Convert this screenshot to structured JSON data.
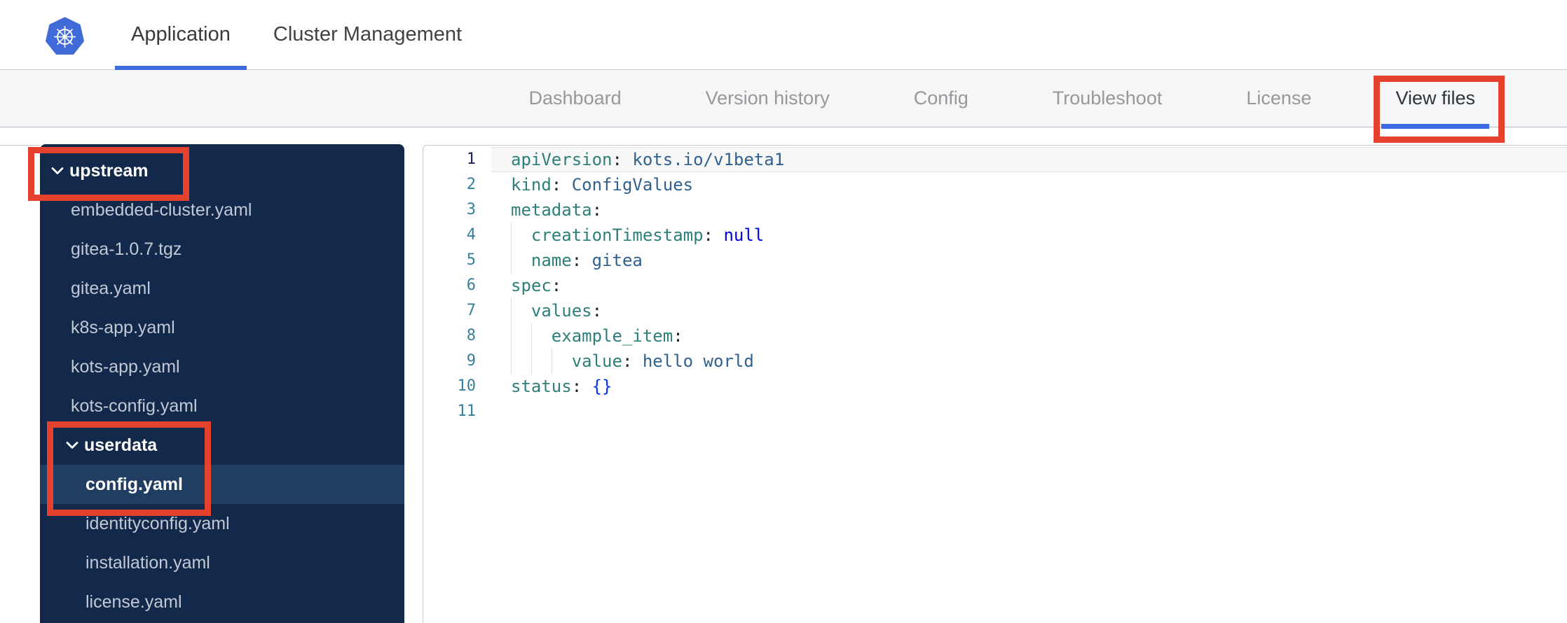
{
  "colors": {
    "header_accent_blue": "#3e6be0",
    "tab_accent_blue": "#3b6ce4",
    "annotation_red": "#e5412d",
    "kubernetes_logo_blue": "#3f6ad8",
    "sidebar_bg": "#13294b",
    "sidebar_selected_bg": "#1f3e61",
    "code_key_teal": "#2e7f79",
    "code_value_blue": "#31618f",
    "code_keyword_blue": "#0000ee",
    "code_bracket_blue": "#0431fa",
    "line_number": "#37809c",
    "line_number_active": "#1b2450"
  },
  "header": {
    "tabs": [
      {
        "label": "Application",
        "active": true
      },
      {
        "label": "Cluster Management",
        "active": false
      }
    ]
  },
  "subnav": {
    "tabs": [
      {
        "label": "Dashboard",
        "active": false
      },
      {
        "label": "Version history",
        "active": false
      },
      {
        "label": "Config",
        "active": false
      },
      {
        "label": "Troubleshoot",
        "active": false
      },
      {
        "label": "License",
        "active": false
      },
      {
        "label": "View files",
        "active": true,
        "annotated": true
      }
    ]
  },
  "file_tree": {
    "items": [
      {
        "type": "folder",
        "label": "upstream",
        "level": 0,
        "expanded": true,
        "annotated": "upstream"
      },
      {
        "type": "file",
        "label": "embedded-cluster.yaml",
        "level": 1
      },
      {
        "type": "file",
        "label": "gitea-1.0.7.tgz",
        "level": 1
      },
      {
        "type": "file",
        "label": "gitea.yaml",
        "level": 1
      },
      {
        "type": "file",
        "label": "k8s-app.yaml",
        "level": 1
      },
      {
        "type": "file",
        "label": "kots-app.yaml",
        "level": 1
      },
      {
        "type": "file",
        "label": "kots-config.yaml",
        "level": 1
      },
      {
        "type": "folder",
        "label": "userdata",
        "level": 1,
        "expanded": true,
        "annotated": "userdata"
      },
      {
        "type": "file",
        "label": "config.yaml",
        "level": 2,
        "selected": true
      },
      {
        "type": "file",
        "label": "identityconfig.yaml",
        "level": 2
      },
      {
        "type": "file",
        "label": "installation.yaml",
        "level": 2
      },
      {
        "type": "file",
        "label": "license.yaml",
        "level": 2
      }
    ]
  },
  "editor": {
    "lines": [
      {
        "num": 1,
        "active": true,
        "indent": 0,
        "tokens": [
          [
            "key",
            "apiVersion"
          ],
          [
            "punc",
            ":"
          ],
          [
            "sp",
            " "
          ],
          [
            "val",
            "kots.io/v1beta1"
          ]
        ]
      },
      {
        "num": 2,
        "indent": 0,
        "tokens": [
          [
            "key",
            "kind"
          ],
          [
            "punc",
            ":"
          ],
          [
            "sp",
            " "
          ],
          [
            "val",
            "ConfigValues"
          ]
        ]
      },
      {
        "num": 3,
        "indent": 0,
        "tokens": [
          [
            "key",
            "metadata"
          ],
          [
            "punc",
            ":"
          ]
        ]
      },
      {
        "num": 4,
        "indent": 2,
        "tokens": [
          [
            "sp",
            "  "
          ],
          [
            "key",
            "creationTimestamp"
          ],
          [
            "punc",
            ":"
          ],
          [
            "sp",
            " "
          ],
          [
            "kw",
            "null"
          ]
        ]
      },
      {
        "num": 5,
        "indent": 2,
        "tokens": [
          [
            "sp",
            "  "
          ],
          [
            "key",
            "name"
          ],
          [
            "punc",
            ":"
          ],
          [
            "sp",
            " "
          ],
          [
            "val",
            "gitea"
          ]
        ]
      },
      {
        "num": 6,
        "indent": 0,
        "tokens": [
          [
            "key",
            "spec"
          ],
          [
            "punc",
            ":"
          ]
        ]
      },
      {
        "num": 7,
        "indent": 2,
        "tokens": [
          [
            "sp",
            "  "
          ],
          [
            "key",
            "values"
          ],
          [
            "punc",
            ":"
          ]
        ]
      },
      {
        "num": 8,
        "indent": 4,
        "tokens": [
          [
            "sp",
            "    "
          ],
          [
            "key",
            "example_item"
          ],
          [
            "punc",
            ":"
          ]
        ]
      },
      {
        "num": 9,
        "indent": 6,
        "tokens": [
          [
            "sp",
            "      "
          ],
          [
            "key",
            "value"
          ],
          [
            "punc",
            ":"
          ],
          [
            "sp",
            " "
          ],
          [
            "val",
            "hello world"
          ]
        ]
      },
      {
        "num": 10,
        "indent": 0,
        "tokens": [
          [
            "key",
            "status"
          ],
          [
            "punc",
            ":"
          ],
          [
            "sp",
            " "
          ],
          [
            "br",
            "{}"
          ]
        ]
      },
      {
        "num": 11,
        "indent": 0,
        "tokens": []
      }
    ]
  }
}
